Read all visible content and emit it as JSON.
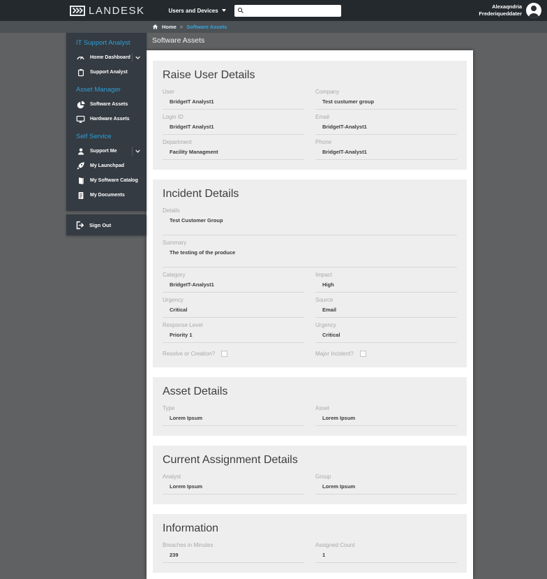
{
  "colors": {
    "accent_blue": "#3aa3d9",
    "topnav_bg": "#24292d",
    "breadcrumb_bg": "#4c5156",
    "sidebar_bg": "#343b42",
    "page_bg": "#5f6163",
    "card_bg": "#eeeeee"
  },
  "header": {
    "logo_text": "LANDESK",
    "scope_dropdown_label": "Users and Devices",
    "user_name_line1": "Alexaqndria",
    "user_name_line2": "Frederiqueddater"
  },
  "breadcrumb": {
    "home": "Home",
    "separator": ">",
    "current": "Software Assets"
  },
  "page_title": "Software Assets",
  "sidebar": {
    "sections": [
      {
        "heading": "IT Support Analyst",
        "items": [
          {
            "label": "Home Dashboard",
            "icon": "gauge-icon",
            "expandable": true
          },
          {
            "label": "Support Analyst",
            "icon": "clipboard-icon",
            "expandable": false
          }
        ]
      },
      {
        "heading": "Asset Manager",
        "items": [
          {
            "label": "Software Assets",
            "icon": "pie-chart-icon",
            "expandable": false
          },
          {
            "label": "Hardware Assets",
            "icon": "monitor-icon",
            "expandable": false
          }
        ]
      },
      {
        "heading": "Self Service",
        "items": [
          {
            "label": "Support Me",
            "icon": "person-icon",
            "expandable": true
          },
          {
            "label": "My Launchpad",
            "icon": "rocket-icon",
            "expandable": false
          },
          {
            "label": "My Software Catalog",
            "icon": "book-icon",
            "expandable": false
          },
          {
            "label": "My Documents",
            "icon": "document-icon",
            "expandable": false
          }
        ]
      }
    ],
    "sign_out_label": "Sign Out"
  },
  "cards": {
    "raise_user_details": {
      "title": "Raise User Details",
      "fields": [
        {
          "label": "User",
          "value": "BridgeIT Analyst1"
        },
        {
          "label": "Company",
          "value": "Test custumer group"
        },
        {
          "label": "Login ID",
          "value": "BridgeIT Analyst1"
        },
        {
          "label": "Email",
          "value": "BridgeIT-Analyst1"
        },
        {
          "label": "Department",
          "value": "Facility Managment"
        },
        {
          "label": "Phone",
          "value": "BridgeIT-Analyst1"
        }
      ]
    },
    "incident_details": {
      "title": "Incident Details",
      "full_fields": [
        {
          "label": "Details",
          "value": "Test Customer Group"
        },
        {
          "label": "Summary",
          "value": "The testing of the produce"
        }
      ],
      "fields": [
        {
          "label": "Category",
          "value": "BridgeIT-Analyst1"
        },
        {
          "label": "Impact",
          "value": "High"
        },
        {
          "label": "Urgency",
          "value": "Critical"
        },
        {
          "label": "Source",
          "value": "Email"
        },
        {
          "label": "Response Level",
          "value": "Priority 1"
        },
        {
          "label": "Urgency",
          "value": "Critical"
        }
      ],
      "checkboxes": [
        {
          "label": "Resolve or Creation?",
          "checked": false
        },
        {
          "label": "Major Incident?",
          "checked": false
        }
      ]
    },
    "asset_details": {
      "title": "Asset Details",
      "fields": [
        {
          "label": "Type",
          "value": "Lorem Ipsum"
        },
        {
          "label": "Asset",
          "value": "Lorem Ipsum"
        }
      ]
    },
    "current_assignment_details": {
      "title": "Current Assignment Details",
      "fields": [
        {
          "label": "Analyst",
          "value": "Lorem Ipsum"
        },
        {
          "label": "Group",
          "value": "Lorem Ipsum"
        }
      ]
    },
    "information": {
      "title": "Information",
      "fields": [
        {
          "label": "Breaches in Minutes",
          "value": "239"
        },
        {
          "label": "Assigned Count",
          "value": "1"
        }
      ]
    }
  }
}
